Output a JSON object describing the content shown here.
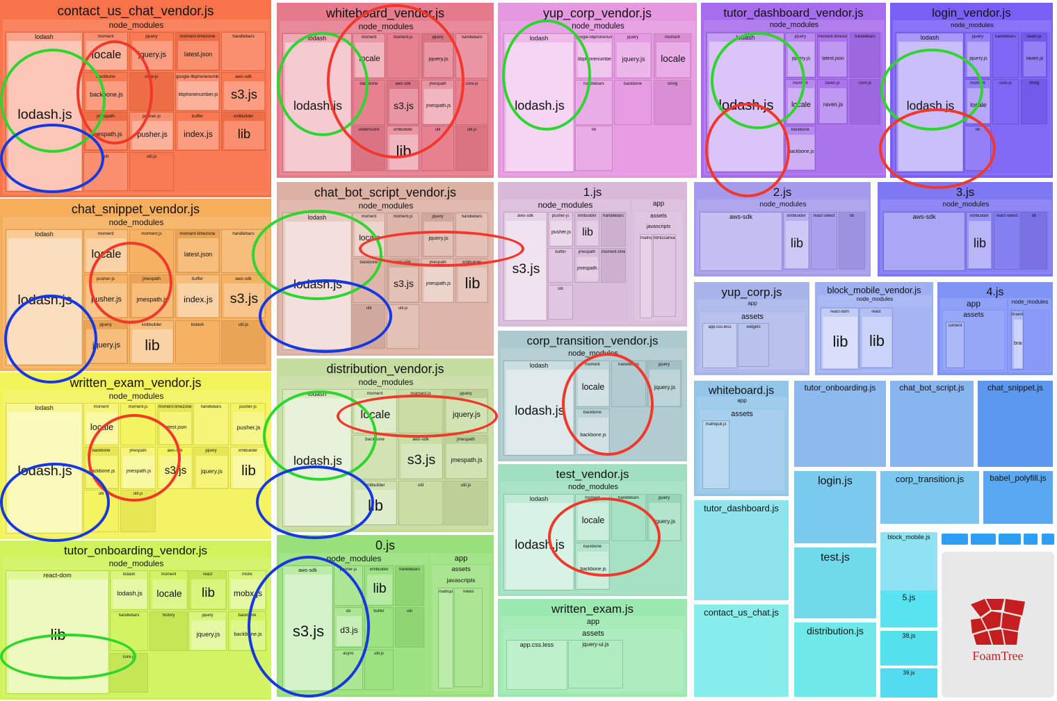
{
  "legend_colors": {
    "red": "#f2372b",
    "green": "#2fd52f",
    "blue": "#1538e0"
  },
  "bundles": [
    {
      "name": "contact_us_chat_vendor.js",
      "color": "#f8734a",
      "children": [
        {
          "name": "node_modules",
          "children": [
            {
              "name": "lodash",
              "big": "lodash.js"
            },
            {
              "name": "moment",
              "big": "locale"
            },
            {
              "name": "jquery",
              "big": "jquery.js"
            },
            {
              "name": "moment-timezone",
              "big": "latest.json"
            },
            {
              "name": "handlebars"
            },
            {
              "name": "backbone",
              "big": "backbone.js"
            },
            {
              "name": "core-js"
            },
            {
              "name": "google-libphonenumber",
              "big": "libphonenumber.js"
            },
            {
              "name": "aws-sdk",
              "big": "s3.js"
            },
            {
              "name": "jmespath",
              "big": "jmespath.js"
            },
            {
              "name": "pusher-js",
              "big": "pusher.js"
            },
            {
              "name": "buffer",
              "big": "index.js"
            },
            {
              "name": "xmlbuilder",
              "big": "lib"
            },
            {
              "name": "util"
            },
            {
              "name": "util.js"
            }
          ]
        }
      ]
    },
    {
      "name": "whiteboard_vendor.js",
      "color": "#e57a8c",
      "children": [
        {
          "name": "node_modules",
          "children": [
            {
              "name": "lodash",
              "big": "lodash.js"
            },
            {
              "name": "moment",
              "big": "locale"
            },
            {
              "name": "moment.js"
            },
            {
              "name": "jquery",
              "big": "jquery.js"
            },
            {
              "name": "handlebars"
            },
            {
              "name": "backbone"
            },
            {
              "name": "aws-sdk",
              "big": "s3.js"
            },
            {
              "name": "jmespath",
              "big": "jmespath.js"
            },
            {
              "name": "core-js"
            },
            {
              "name": "underscore"
            },
            {
              "name": "xmlbuilder",
              "big": "lib"
            },
            {
              "name": "util"
            },
            {
              "name": "util.js"
            }
          ]
        }
      ]
    },
    {
      "name": "yup_corp_vendor.js",
      "color": "#e597e0",
      "children": [
        {
          "name": "node_modules",
          "children": [
            {
              "name": "lodash",
              "big": "lodash.js"
            },
            {
              "name": "google-libphonenumber",
              "big": "libphonenumber.js"
            },
            {
              "name": "jquery",
              "big": "jquery.js"
            },
            {
              "name": "moment",
              "big": "locale"
            },
            {
              "name": "handlebars"
            },
            {
              "name": "backbone"
            },
            {
              "name": "string"
            },
            {
              "name": "lib"
            }
          ]
        }
      ]
    },
    {
      "name": "tutor_dashboard_vendor.js",
      "color": "#a56ceb",
      "children": [
        {
          "name": "node_modules",
          "children": [
            {
              "name": "lodash",
              "big": "lodash.js"
            },
            {
              "name": "jquery",
              "big": "jquery.js"
            },
            {
              "name": "moment-timezone",
              "big": "latest.json"
            },
            {
              "name": "handlebars"
            },
            {
              "name": "moment",
              "big": "locale"
            },
            {
              "name": "raven-js",
              "big": "raven.js"
            },
            {
              "name": "core-js"
            },
            {
              "name": "backbone",
              "big": "backbone.js"
            }
          ]
        }
      ]
    },
    {
      "name": "login_vendor.js",
      "color": "#7b5ff5",
      "children": [
        {
          "name": "node_modules",
          "children": [
            {
              "name": "lodash",
              "big": "lodash.js"
            },
            {
              "name": "jquery",
              "big": "jquery.js"
            },
            {
              "name": "handlebars"
            },
            {
              "name": "raven-js",
              "big": "raven.js"
            },
            {
              "name": "moment",
              "big": "locale"
            },
            {
              "name": "core-js"
            },
            {
              "name": "string"
            },
            {
              "name": "lib"
            }
          ]
        }
      ]
    },
    {
      "name": "chat_snippet_vendor.js",
      "color": "#f5ad5b",
      "children": [
        {
          "name": "node_modules",
          "children": [
            {
              "name": "lodash",
              "big": "lodash.js"
            },
            {
              "name": "moment",
              "big": "locale"
            },
            {
              "name": "moment.js"
            },
            {
              "name": "moment-timezone",
              "big": "latest.json"
            },
            {
              "name": "handlebars"
            },
            {
              "name": "pusher-js",
              "big": "pusher.js"
            },
            {
              "name": "jmespath",
              "big": "jmespath.js"
            },
            {
              "name": "buffer",
              "big": "index.js"
            },
            {
              "name": "aws-sdk",
              "big": "s3.js"
            },
            {
              "name": "jquery",
              "big": "jquery.js"
            },
            {
              "name": "xmlbuilder",
              "big": "lib"
            },
            {
              "name": "lodash"
            },
            {
              "name": "util.js"
            }
          ]
        }
      ]
    },
    {
      "name": "chat_bot_script_vendor.js",
      "color": "#dcb1a4",
      "children": [
        {
          "name": "node_modules",
          "children": [
            {
              "name": "lodash",
              "big": "lodash.js"
            },
            {
              "name": "moment",
              "big": "locale"
            },
            {
              "name": "moment.js"
            },
            {
              "name": "jquery",
              "big": "jquery.js"
            },
            {
              "name": "handlebars"
            },
            {
              "name": "backbone"
            },
            {
              "name": "aws-sdk",
              "big": "s3.js"
            },
            {
              "name": "jmespath",
              "big": "jmespath.js"
            },
            {
              "name": "xmlbuilder",
              "big": "lib"
            },
            {
              "name": "util"
            },
            {
              "name": "util.js"
            }
          ]
        }
      ]
    },
    {
      "name": "written_exam_vendor.js",
      "color": "#f4f259",
      "children": [
        {
          "name": "node_modules",
          "children": [
            {
              "name": "lodash",
              "big": "lodash.js"
            },
            {
              "name": "moment",
              "big": "locale"
            },
            {
              "name": "moment.js"
            },
            {
              "name": "moment-timezone",
              "big": "latest.json"
            },
            {
              "name": "handlebars"
            },
            {
              "name": "pusher-js",
              "big": "pusher.js"
            },
            {
              "name": "backbone",
              "big": "backbone.js"
            },
            {
              "name": "jmespath",
              "big": "jmespath.js"
            },
            {
              "name": "aws-sdk",
              "big": "s3.js"
            },
            {
              "name": "jquery",
              "big": "jquery.js"
            },
            {
              "name": "xmlbuilder",
              "big": "lib"
            },
            {
              "name": "util"
            },
            {
              "name": "util.js"
            }
          ]
        }
      ]
    },
    {
      "name": "distribution_vendor.js",
      "color": "#c5dca0",
      "children": [
        {
          "name": "node_modules",
          "children": [
            {
              "name": "lodash",
              "big": "lodash.js"
            },
            {
              "name": "moment",
              "big": "locale"
            },
            {
              "name": "moment.js"
            },
            {
              "name": "jquery",
              "big": "jquery.js"
            },
            {
              "name": "backbone"
            },
            {
              "name": "aws-sdk",
              "big": "s3.js"
            },
            {
              "name": "jmespath",
              "big": "jmespath.js"
            },
            {
              "name": "xmlbuilder",
              "big": "lib"
            },
            {
              "name": "util"
            },
            {
              "name": "util.js"
            }
          ]
        }
      ]
    },
    {
      "name": "tutor_onboarding_vendor.js",
      "color": "#cff35a",
      "children": [
        {
          "name": "node_modules",
          "children": [
            {
              "name": "react-dom",
              "big": "lib"
            },
            {
              "name": "lodash",
              "big": "lodash.js"
            },
            {
              "name": "moment",
              "big": "locale"
            },
            {
              "name": "react",
              "big": "lib"
            },
            {
              "name": "mobx",
              "big": "mobx.js"
            },
            {
              "name": "handlebars"
            },
            {
              "name": "history"
            },
            {
              "name": "jquery",
              "big": "jquery.js"
            },
            {
              "name": "backbone",
              "big": "backbone.js"
            },
            {
              "name": "core-js"
            }
          ]
        }
      ]
    },
    {
      "name": "1.js",
      "color": "#d9b8da",
      "children": [
        {
          "name": "node_modules",
          "children": [
            {
              "name": "aws-sdk",
              "big": "s3.js"
            },
            {
              "name": "pusher-js",
              "big": "pusher.js"
            },
            {
              "name": "xmlbuilder",
              "big": "lib"
            },
            {
              "name": "handlebars"
            },
            {
              "name": "buffer"
            },
            {
              "name": "jmespath",
              "big": "jmespath.js"
            },
            {
              "name": "moment-timezone"
            },
            {
              "name": "util"
            }
          ]
        },
        {
          "name": "app",
          "children": [
            {
              "name": "assets",
              "children": [
                {
                  "name": "javascripts",
                  "children": [
                    {
                      "name": "mathquill.js"
                    },
                    {
                      "name": "html2canvas.js"
                    }
                  ]
                }
              ]
            }
          ]
        }
      ]
    },
    {
      "name": "0.js",
      "color": "#97e07a",
      "children": [
        {
          "name": "node_modules",
          "children": [
            {
              "name": "aws-sdk",
              "big": "s3.js"
            },
            {
              "name": "pusher-js"
            },
            {
              "name": "xmlbuilder",
              "big": "lib"
            },
            {
              "name": "handlebars"
            },
            {
              "name": "d3",
              "big": "d3.js"
            },
            {
              "name": "buffer"
            },
            {
              "name": "util"
            },
            {
              "name": "async"
            },
            {
              "name": "util.js"
            }
          ]
        },
        {
          "name": "app",
          "children": [
            {
              "name": "assets",
              "children": [
                {
                  "name": "javascripts",
                  "children": [
                    {
                      "name": "mathquill.js"
                    },
                    {
                      "name": "Views"
                    }
                  ]
                }
              ]
            }
          ]
        }
      ]
    },
    {
      "name": "corp_transition_vendor.js",
      "color": "#acc9cd",
      "children": [
        {
          "name": "node_modules",
          "children": [
            {
              "name": "lodash",
              "big": "lodash.js"
            },
            {
              "name": "moment",
              "big": "locale"
            },
            {
              "name": "handlebars"
            },
            {
              "name": "jquery",
              "big": "jquery.js"
            },
            {
              "name": "backbone",
              "big": "backbone.js"
            }
          ]
        }
      ]
    },
    {
      "name": "test_vendor.js",
      "color": "#a0dfc0",
      "children": [
        {
          "name": "node_modules",
          "children": [
            {
              "name": "lodash",
              "big": "lodash.js"
            },
            {
              "name": "moment",
              "big": "locale"
            },
            {
              "name": "handlebars"
            },
            {
              "name": "jquery",
              "big": "jquery.js"
            },
            {
              "name": "backbone",
              "big": "backbone.js"
            }
          ]
        }
      ]
    },
    {
      "name": "written_exam.js",
      "color": "#9be8b0",
      "children": [
        {
          "name": "app",
          "children": [
            {
              "name": "assets",
              "children": [
                {
                  "name": "app.css.less"
                },
                {
                  "name": "jquery-ui.js"
                }
              ]
            }
          ]
        }
      ]
    },
    {
      "name": "2.js",
      "color": "#a49bec",
      "children": [
        {
          "name": "node_modules",
          "children": [
            {
              "name": "aws-sdk"
            },
            {
              "name": "xmlbuilder",
              "big": "lib"
            },
            {
              "name": "react-select"
            },
            {
              "name": "lib"
            }
          ]
        }
      ]
    },
    {
      "name": "3.js",
      "color": "#7e78f2",
      "children": [
        {
          "name": "node_modules",
          "children": [
            {
              "name": "aws-sdk"
            },
            {
              "name": "xmlbuilder",
              "big": "lib"
            },
            {
              "name": "react-select"
            },
            {
              "name": "lib"
            }
          ]
        }
      ]
    },
    {
      "name": "yup_corp.js",
      "color": "#a8b3e9",
      "children": [
        {
          "name": "app",
          "children": [
            {
              "name": "assets",
              "children": [
                {
                  "name": "app.css.less"
                },
                {
                  "name": "widgets"
                }
              ]
            }
          ]
        }
      ]
    },
    {
      "name": "block_mobile_vendor.js",
      "color": "#9fb0f2",
      "children": [
        {
          "name": "node_modules",
          "children": [
            {
              "name": "react-dom",
              "big": "lib"
            },
            {
              "name": "react",
              "big": "lib"
            }
          ]
        }
      ]
    },
    {
      "name": "4.js",
      "color": "#8094f5",
      "children": [
        {
          "name": "app",
          "children": [
            {
              "name": "assets",
              "children": [
                {
                  "name": "content"
                }
              ]
            }
          ]
        },
        {
          "name": "node_modules",
          "children": [
            {
              "name": "braintree-web",
              "big": "braintree.js"
            }
          ]
        }
      ]
    },
    {
      "name": "whiteboard.js",
      "color": "#93c5e9",
      "children": [
        {
          "name": "app",
          "children": [
            {
              "name": "assets",
              "children": [
                {
                  "name": "mathquill.js"
                }
              ]
            }
          ]
        }
      ]
    },
    {
      "name": "tutor_onboarding.js",
      "color": "#8db9ef"
    },
    {
      "name": "chat_bot_script.js",
      "color": "#88b5f0"
    },
    {
      "name": "chat_snippet.js",
      "color": "#5d98ef"
    },
    {
      "name": "tutor_dashboard.js",
      "color": "#8ee3ed"
    },
    {
      "name": "login.js",
      "color": "#7bc9ed"
    },
    {
      "name": "corp_transition.js",
      "color": "#7bc7ef"
    },
    {
      "name": "babel_polyfill.js",
      "color": "#5aa8f0"
    },
    {
      "name": "test.js",
      "color": "#72d9ea"
    },
    {
      "name": "block_mobile.js",
      "color": "#8fe2f1"
    },
    {
      "name": "contact_us_chat.js",
      "color": "#86ecec"
    },
    {
      "name": "distribution.js",
      "color": "#6fe8ea"
    },
    {
      "name": "5.js",
      "color": "#59e3f0"
    },
    {
      "name": "38.js",
      "color": "#55e0ed"
    },
    {
      "name": "39.js",
      "color": "#53dcef"
    }
  ],
  "brand": {
    "name": "FoamTree",
    "color": "#c41e1e",
    "tile_bg": "#e8e8e8"
  }
}
